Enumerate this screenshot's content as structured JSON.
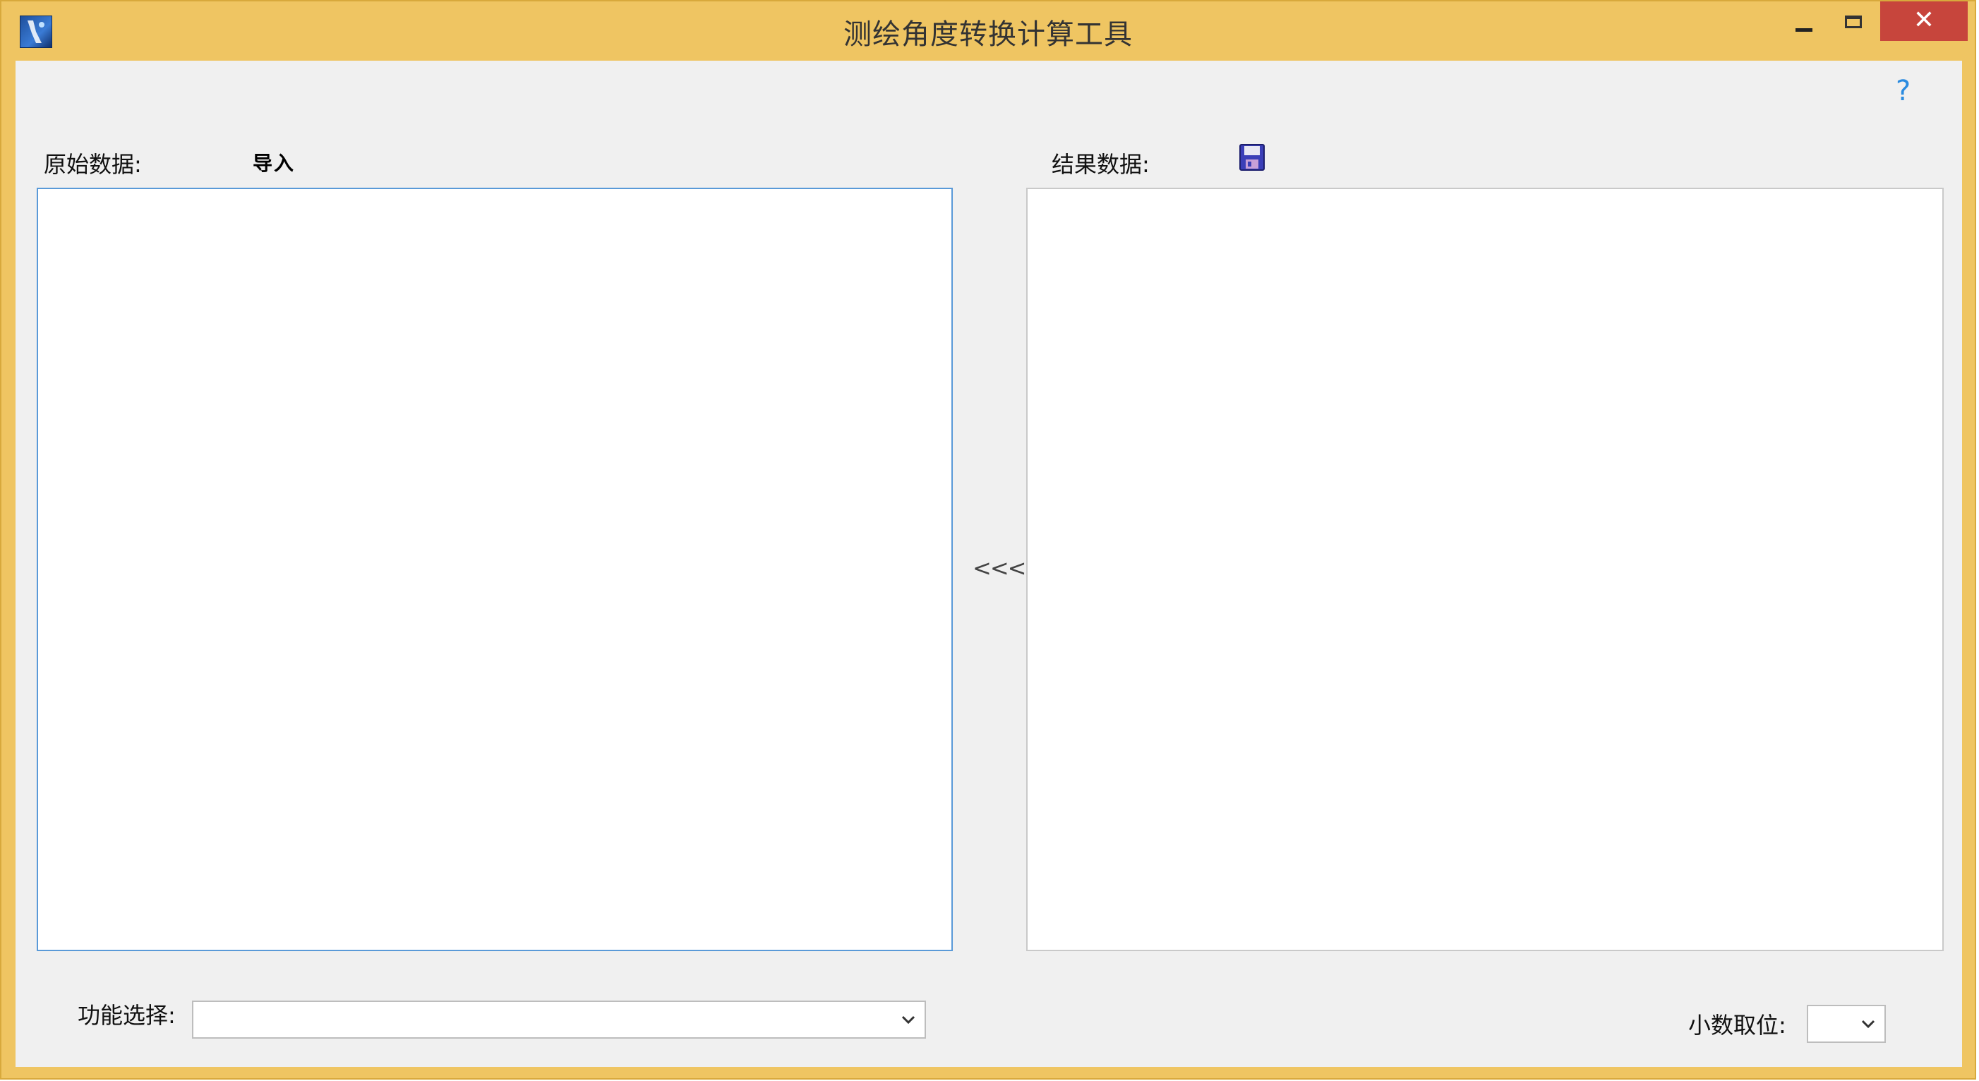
{
  "window": {
    "title": "测绘角度转换计算工具",
    "icon": "app-logo-icon",
    "controls": [
      "minimize-icon",
      "maximize-icon",
      "close-icon"
    ],
    "accent": "#efc562",
    "close_color": "#c7453c"
  },
  "help": {
    "icon": "help-question-icon",
    "glyph": "?"
  },
  "raw": {
    "label": "原始数据:",
    "import_label": "导入",
    "value": ""
  },
  "result": {
    "label": "结果数据:",
    "save_icon": "save-floppy-icon",
    "value": ""
  },
  "convert_button": {
    "label": "<<<"
  },
  "function_select": {
    "label": "功能选择:",
    "selected": ""
  },
  "decimal_select": {
    "label": "小数取位:",
    "selected": ""
  }
}
